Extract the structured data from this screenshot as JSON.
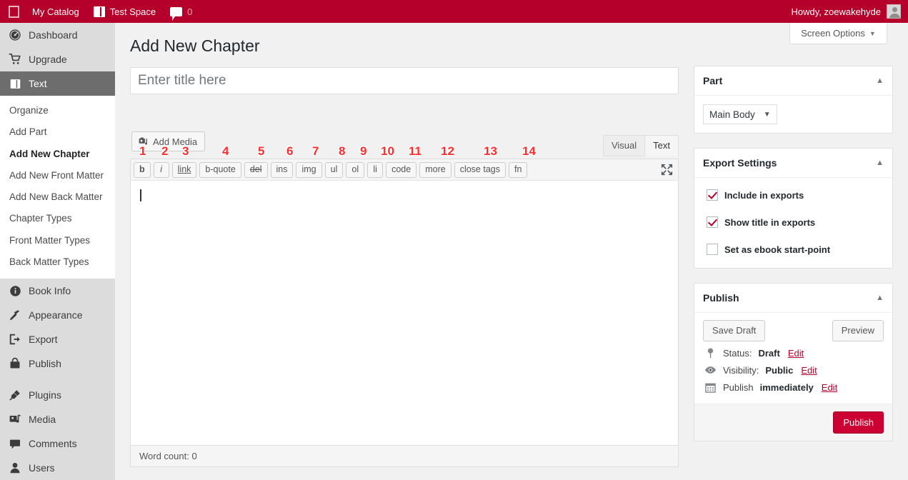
{
  "adminbar": {
    "wp_logo": "wordpress-logo-icon",
    "catalog_label": "My Catalog",
    "site_label": "Test Space",
    "comment_count": "0",
    "howdy": "Howdy, zoewakehyde"
  },
  "screen_options": {
    "label": "Screen Options",
    "caret": "▼"
  },
  "sidebar": {
    "items": [
      {
        "label": "Dashboard",
        "icon": "dashboard-icon",
        "current": false
      },
      {
        "label": "Upgrade",
        "icon": "cart-icon",
        "current": false
      },
      {
        "label": "Text",
        "icon": "book-icon",
        "current": true
      }
    ],
    "submenu": [
      {
        "label": "Organize",
        "current": false
      },
      {
        "label": "Add Part",
        "current": false
      },
      {
        "label": "Add New Chapter",
        "current": true
      },
      {
        "label": "Add New Front Matter",
        "current": false
      },
      {
        "label": "Add New Back Matter",
        "current": false
      },
      {
        "label": "Chapter Types",
        "current": false
      },
      {
        "label": "Front Matter Types",
        "current": false
      },
      {
        "label": "Back Matter Types",
        "current": false
      }
    ],
    "items2": [
      {
        "label": "Book Info",
        "icon": "info-icon"
      },
      {
        "label": "Appearance",
        "icon": "brush-icon"
      },
      {
        "label": "Export",
        "icon": "export-icon"
      },
      {
        "label": "Publish",
        "icon": "store-icon"
      }
    ],
    "items3": [
      {
        "label": "Plugins",
        "icon": "plug-icon"
      },
      {
        "label": "Media",
        "icon": "media-icon"
      },
      {
        "label": "Comments",
        "icon": "comment-icon"
      },
      {
        "label": "Users",
        "icon": "user-icon"
      }
    ]
  },
  "main": {
    "page_title": "Add New Chapter",
    "title_placeholder": "Enter title here",
    "title_value": "",
    "add_media_label": "Add Media",
    "editor_tabs": [
      {
        "label": "Visual",
        "active": false
      },
      {
        "label": "Text",
        "active": true
      }
    ],
    "quicktag_buttons": [
      {
        "label": "b",
        "style": "b"
      },
      {
        "label": "i",
        "style": "i"
      },
      {
        "label": "link",
        "style": "u"
      },
      {
        "label": "b-quote",
        "style": ""
      },
      {
        "label": "del",
        "style": "s"
      },
      {
        "label": "ins",
        "style": ""
      },
      {
        "label": "img",
        "style": ""
      },
      {
        "label": "ul",
        "style": ""
      },
      {
        "label": "ol",
        "style": ""
      },
      {
        "label": "li",
        "style": ""
      },
      {
        "label": "code",
        "style": ""
      },
      {
        "label": "more",
        "style": ""
      },
      {
        "label": "close tags",
        "style": ""
      },
      {
        "label": "fn",
        "style": ""
      }
    ],
    "annotation_badges": [
      "1",
      "2",
      "3",
      "4",
      "5",
      "6",
      "7",
      "8",
      "9",
      "10",
      "11",
      "12",
      "13",
      "14"
    ],
    "fullscreen_icon": "fullscreen-icon",
    "editor_content": "",
    "word_count_label": "Word count: 0"
  },
  "part_box": {
    "title": "Part",
    "caret": "▲",
    "selected": "Main Body",
    "select_caret": "▼"
  },
  "export_box": {
    "title": "Export Settings",
    "caret": "▲",
    "options": [
      {
        "label": "Include in exports",
        "checked": true
      },
      {
        "label": "Show title in exports",
        "checked": true
      },
      {
        "label": "Set as ebook start-point",
        "checked": false
      }
    ]
  },
  "publish_box": {
    "title": "Publish",
    "caret": "▲",
    "save_draft_label": "Save Draft",
    "preview_label": "Preview",
    "status_prefix": "Status:",
    "status_value": "Draft",
    "status_edit": "Edit",
    "visibility_prefix": "Visibility:",
    "visibility_value": "Public",
    "visibility_edit": "Edit",
    "publish_prefix": "Publish",
    "publish_value": "immediately",
    "publish_edit": "Edit",
    "publish_button": "Publish"
  },
  "colors": {
    "brand_red": "#b5002b",
    "publish_red": "#cc0033",
    "annotation_red": "#ff2d2d",
    "sidebar_bg": "#dcdcdc",
    "current_menu_bg": "#6d6d6d",
    "page_bg": "#f1f1f1"
  }
}
